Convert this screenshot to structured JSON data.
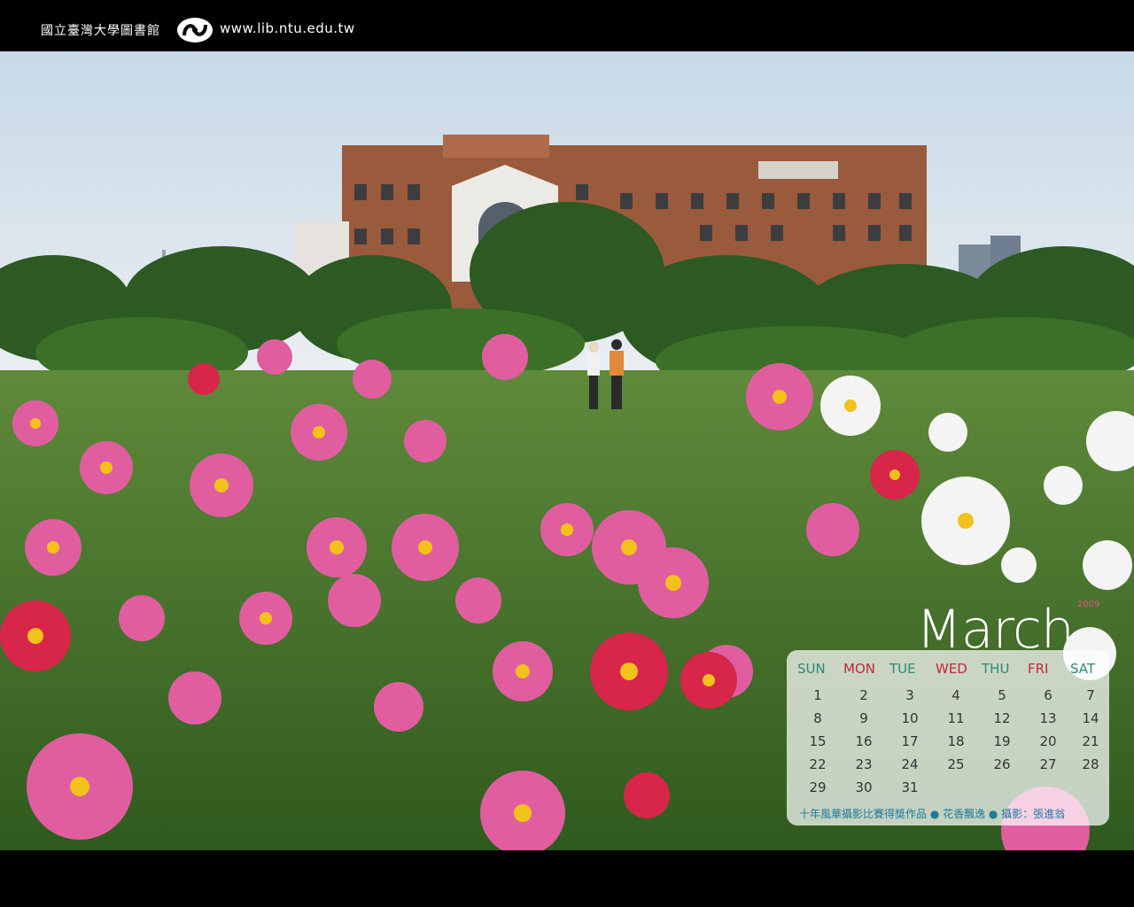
{
  "header": {
    "org_name": "國立臺灣大學圖書館",
    "logo_icon": "ntu-library-logo-icon",
    "url": "www.lib.ntu.edu.tw"
  },
  "photo": {
    "scene_icon": "library-garden-photo"
  },
  "calendar": {
    "month": "March",
    "year": "2009",
    "weekdays": [
      {
        "label": "SUN",
        "color": "#2a8a78"
      },
      {
        "label": "MON",
        "color": "#c02a3a"
      },
      {
        "label": "TUE",
        "color": "#2a8a78"
      },
      {
        "label": "WED",
        "color": "#c02a3a"
      },
      {
        "label": "THU",
        "color": "#2a8a78"
      },
      {
        "label": "FRI",
        "color": "#c02a3a"
      },
      {
        "label": "SAT",
        "color": "#2a8a78"
      }
    ],
    "days": [
      1,
      2,
      3,
      4,
      5,
      6,
      7,
      8,
      9,
      10,
      11,
      12,
      13,
      14,
      15,
      16,
      17,
      18,
      19,
      20,
      21,
      22,
      23,
      24,
      25,
      26,
      27,
      28,
      29,
      30,
      31
    ],
    "credit": "十年風華攝影比賽得獎作品 ● 花香飄逸 ● 攝影：張進翁"
  },
  "colors": {
    "accent_teal": "#1d7a9c",
    "accent_red": "#c02a3a",
    "year_pink": "#e0508a"
  }
}
